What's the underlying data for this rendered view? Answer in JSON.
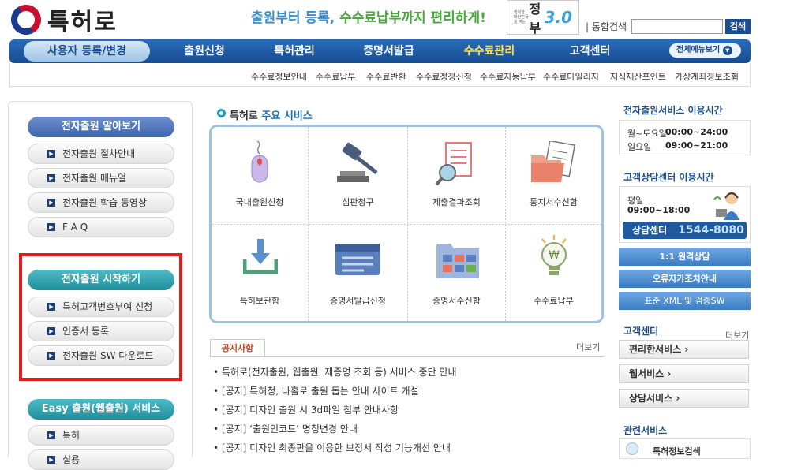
{
  "header": {
    "logo_text": "특허로",
    "slogan_blue": "출원부터 등록, ",
    "slogan_green": "수수료납부까지 편리하게!",
    "gov_small": "행복한 대한민국을 여는",
    "gov_big": "정부",
    "gov_version": "3.0",
    "search_label": "| 통합검색",
    "search_value": "",
    "search_button": "검색"
  },
  "nav": {
    "items": [
      {
        "label": "사용자 등록/변경"
      },
      {
        "label": "출원신청"
      },
      {
        "label": "특허관리"
      },
      {
        "label": "증명서발급"
      },
      {
        "label": "수수료관리"
      },
      {
        "label": "고객센터"
      }
    ],
    "all_menu": "전체메뉴보기"
  },
  "subnav": [
    "수수료정보안내",
    "수수료납부",
    "수수료반환",
    "수수료정정신청",
    "수수료자동납부",
    "수수료마일리지",
    "지식재산포인트",
    "가상계좌정보조회"
  ],
  "left": {
    "section1": {
      "title": "전자출원 알아보기",
      "items": [
        "전자출원 절차안내",
        "전자출원 매뉴얼",
        "전자출원 학습 동영상",
        "F A Q"
      ]
    },
    "section2": {
      "title": "전자출원 시작하기",
      "items": [
        "특허고객번호부여 신청",
        "인증서 등록",
        "전자출원 SW 다운로드"
      ]
    },
    "section3": {
      "title": "Easy 출원(웹출원) 서비스",
      "items": [
        "특허",
        "실용"
      ]
    }
  },
  "services": {
    "title_pre": "특허로",
    "title_post": " 주요 서비스",
    "items": [
      {
        "label": "국내출원신청",
        "icon": "mouse-icon"
      },
      {
        "label": "심판청구",
        "icon": "gavel-icon"
      },
      {
        "label": "제출결과조회",
        "icon": "document-search-icon"
      },
      {
        "label": "통지서수신함",
        "icon": "folder-icon"
      },
      {
        "label": "특허보관함",
        "icon": "download-tray-icon"
      },
      {
        "label": "증명서발급신청",
        "icon": "certificate-icon"
      },
      {
        "label": "증명서수신함",
        "icon": "calendar-folder-icon"
      },
      {
        "label": "수수료납부",
        "icon": "lightbulb-won-icon"
      }
    ]
  },
  "notice": {
    "tab": "공지사항",
    "more": "더보기",
    "items": [
      "특허로(전자출원, 웹출원, 제증명 조회 등) 서비스 중단 안내",
      "[공지] 특허청, 나홀로 출원 돕는 안내 사이트 개설",
      "[공지] 디자인 출원 시 3d파일 첨부 안내사항",
      "[공지] ‘출원인코드’ 명칭변경 안내",
      "[공지] 디자인 최종판을 이용한 보정서 작성 기능개선 안내"
    ]
  },
  "right": {
    "hours_title": "전자출원서비스 이용시간",
    "hours": [
      {
        "day": "월~토요일",
        "time": "00:00~24:00"
      },
      {
        "day": "일요일",
        "time": "09:00~21:00"
      }
    ],
    "center_title": "고객상담센터 이용시간",
    "center_day": "평일",
    "center_time": "09:00~18:00",
    "center_label": "상담센터",
    "center_phone": "1544-8080",
    "buttons": [
      "1:1 원격상담",
      "오류자가조치안내",
      "표준 XML 및 검증SW"
    ],
    "cs_title": "고객센터",
    "cs_more": "더보기",
    "cs_links": [
      "편리한서비스 ›",
      "웹서비스 ›",
      "상담서비스 ›"
    ],
    "related_title": "관련서비스",
    "related_item": "특허정보검색"
  },
  "colors": {
    "nav": "#1f5ca3",
    "accent_teal": "#1f8f9c",
    "highlight_red": "#e21b1b"
  }
}
